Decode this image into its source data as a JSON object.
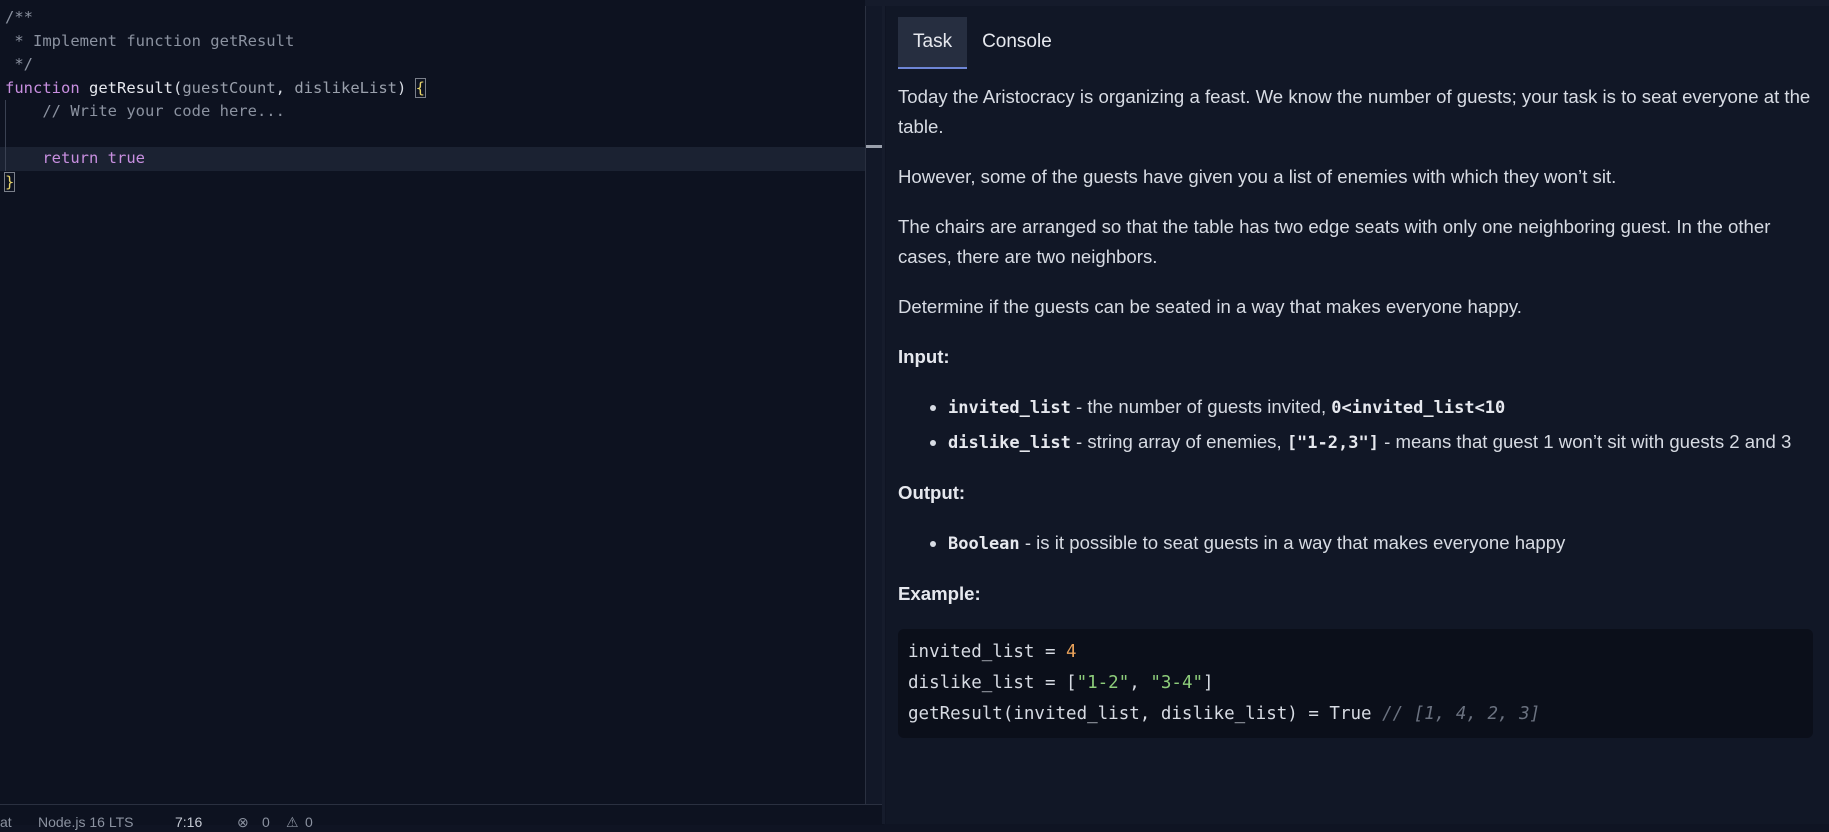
{
  "editor": {
    "lines": [
      {
        "parts": [
          {
            "cls": "c-comment",
            "t": "/**"
          }
        ]
      },
      {
        "parts": [
          {
            "cls": "c-comment",
            "t": " * Implement function getResult"
          }
        ]
      },
      {
        "parts": [
          {
            "cls": "c-comment",
            "t": " */"
          }
        ]
      },
      {
        "parts": [
          {
            "cls": "c-kw",
            "t": "function "
          },
          {
            "cls": "c-fn",
            "t": "getResult"
          },
          {
            "cls": "c-punct",
            "t": "("
          },
          {
            "cls": "c-param",
            "t": "guestCount"
          },
          {
            "cls": "c-punct",
            "t": ", "
          },
          {
            "cls": "c-param",
            "t": "dislikeList"
          },
          {
            "cls": "c-punct",
            "t": ") "
          },
          {
            "cls": "c-brace",
            "t": "{"
          }
        ]
      },
      {
        "parts": [
          {
            "cls": "c-comment",
            "t": "    // Write your code here..."
          }
        ]
      },
      {
        "parts": [
          {
            "cls": "c-punct",
            "t": ""
          }
        ]
      },
      {
        "active": true,
        "parts": [
          {
            "cls": "c-kw",
            "t": "    return "
          },
          {
            "cls": "c-kw",
            "t": "true"
          }
        ]
      },
      {
        "parts": [
          {
            "cls": "c-brace",
            "t": "}"
          }
        ]
      }
    ]
  },
  "status": {
    "mode": "at",
    "runtime": "Node.js 16 LTS",
    "cursor": "7:16",
    "errors": "0",
    "warnings": "0"
  },
  "tabs": [
    {
      "label": "Task"
    },
    {
      "label": "Console"
    }
  ],
  "task": {
    "p1": "Today the Aristocracy is organizing a feast. We know the number of guests; your task is to seat everyone at the table.",
    "p2": "However, some of the guests have given you a list of enemies with which they won’t sit.",
    "p3": "The chairs are arranged so that the table has two edge seats with only one neighboring guest. In the other cases, there are two neighbors.",
    "p4": "Determine if the guests can be seated in a way that makes everyone happy.",
    "input_heading": "Input:",
    "input1_code": "invited_list",
    "input1_text": " - the number of guests invited, ",
    "input1_range": "0<invited_list<10",
    "input2_code": "dislike_list",
    "input2_text": " - string array of enemies, ",
    "input2_example": "[\"1-2,3\"]",
    "input2_text2": " - means that guest 1 won’t sit with guests 2 and 3",
    "output_heading": "Output:",
    "output1_code": "Boolean",
    "output1_text": " - is it possible to seat guests in a way that makes everyone happy",
    "example_heading": "Example:",
    "ex_line1_a": "invited_list = ",
    "ex_line1_num": "4",
    "ex_line2_a": "dislike_list = [",
    "ex_line2_s1": "\"1-2\"",
    "ex_line2_b": ", ",
    "ex_line2_s2": "\"3-4\"",
    "ex_line2_c": "]",
    "ex_line3_a": "getResult(invited_list, dislike_list) = True ",
    "ex_line3_com": "// [1, 4, 2, 3]"
  }
}
